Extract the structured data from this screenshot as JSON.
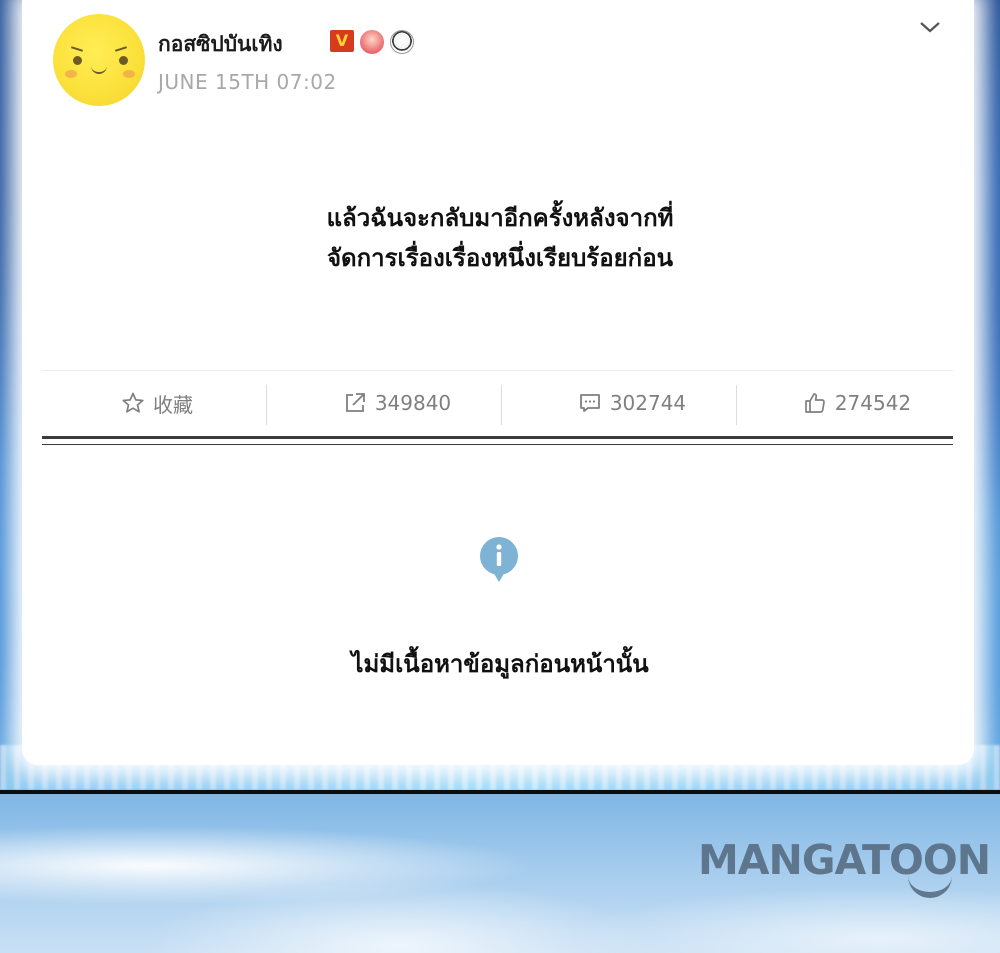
{
  "post": {
    "username": "กอสซิปบันเทิง",
    "verified_badge": "V",
    "timestamp": "JUNE 15TH 07:02",
    "text_line1": "แล้วฉันจะกลับมาอีกครั้งหลังจากที่",
    "text_line2": "จัดการเรื่องเรื่องหนึ่งเรียบร้อยก่อน"
  },
  "actions": {
    "favorite_label": "收藏",
    "share_count": "349840",
    "comment_count": "302744",
    "like_count": "274542"
  },
  "empty_state": {
    "icon": "info-icon",
    "message": "ไม่มีเนื้อหาข้อมูลก่อนหน้านั้น"
  },
  "watermark": {
    "brand": "MANGATOON"
  },
  "colors": {
    "avatar": "#fbe03a",
    "badge_v": "#d63b1e",
    "muted_text": "#a8a8a8",
    "action_text": "#7f7f7f",
    "info_icon": "#7fb3d6",
    "brand": "#53687d"
  }
}
